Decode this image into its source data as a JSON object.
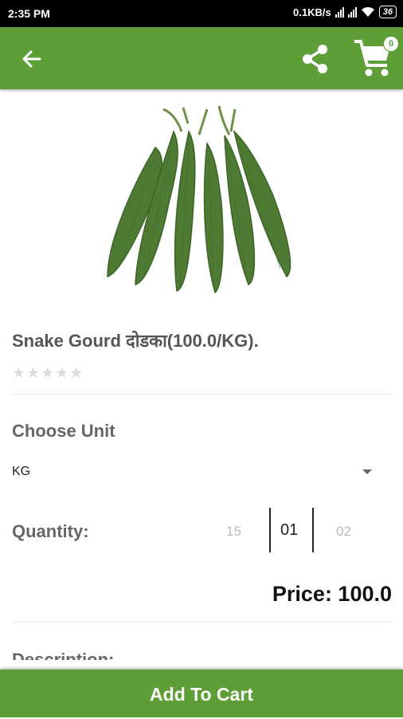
{
  "status_bar": {
    "time": "2:35 PM",
    "network_speed": "0.1KB/s",
    "battery": "36"
  },
  "app_bar": {
    "back_icon": "arrow-left-icon",
    "share_icon": "share-icon",
    "cart_icon": "shopping-cart-icon",
    "cart_count": "0"
  },
  "product": {
    "image": "snake-gourd-image",
    "title": "Snake Gourd दोडका(100.0/KG).",
    "rating": 0,
    "stars_total": 5
  },
  "options": {
    "choose_unit_label": "Choose Unit",
    "unit_value": "KG",
    "quantity_label": "Quantity:",
    "quantity_prev": "15",
    "quantity_current": "01",
    "quantity_next": "02"
  },
  "price_text": "Price: 100.0",
  "description_label": "Description:",
  "add_to_cart_label": "Add To Cart",
  "colors": {
    "primary": "#5e9e36",
    "star_empty": "#dcdcdc"
  }
}
